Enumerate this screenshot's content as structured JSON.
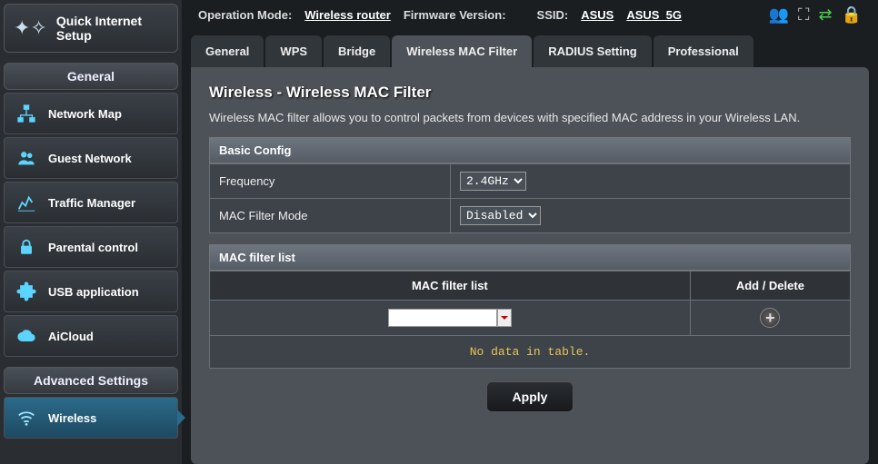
{
  "topbar": {
    "op_mode_label": "Operation Mode:",
    "op_mode_value": "Wireless router",
    "fw_label": "Firmware Version:",
    "ssid_label": "SSID:",
    "ssid1": "ASUS",
    "ssid2": "ASUS_5G"
  },
  "qis": {
    "label": "Quick Internet Setup"
  },
  "sections": {
    "general": "General",
    "advanced": "Advanced Settings"
  },
  "nav": {
    "network_map": "Network Map",
    "guest_network": "Guest Network",
    "traffic_manager": "Traffic Manager",
    "parental_control": "Parental control",
    "usb_application": "USB application",
    "aicloud": "AiCloud",
    "wireless": "Wireless"
  },
  "tabs": {
    "general": "General",
    "wps": "WPS",
    "bridge": "Bridge",
    "macfilter": "Wireless MAC Filter",
    "radius": "RADIUS Setting",
    "professional": "Professional"
  },
  "page": {
    "title": "Wireless - Wireless MAC Filter",
    "desc": "Wireless MAC filter allows you to control packets from devices with specified MAC address in your Wireless LAN.",
    "basic_config": "Basic Config",
    "frequency_label": "Frequency",
    "frequency_value": "2.4GHz",
    "mode_label": "MAC Filter Mode",
    "mode_value": "Disabled",
    "maclist_header": "MAC filter list",
    "col_list": "MAC filter list",
    "col_action": "Add / Delete",
    "empty": "No data in table.",
    "apply": "Apply"
  }
}
